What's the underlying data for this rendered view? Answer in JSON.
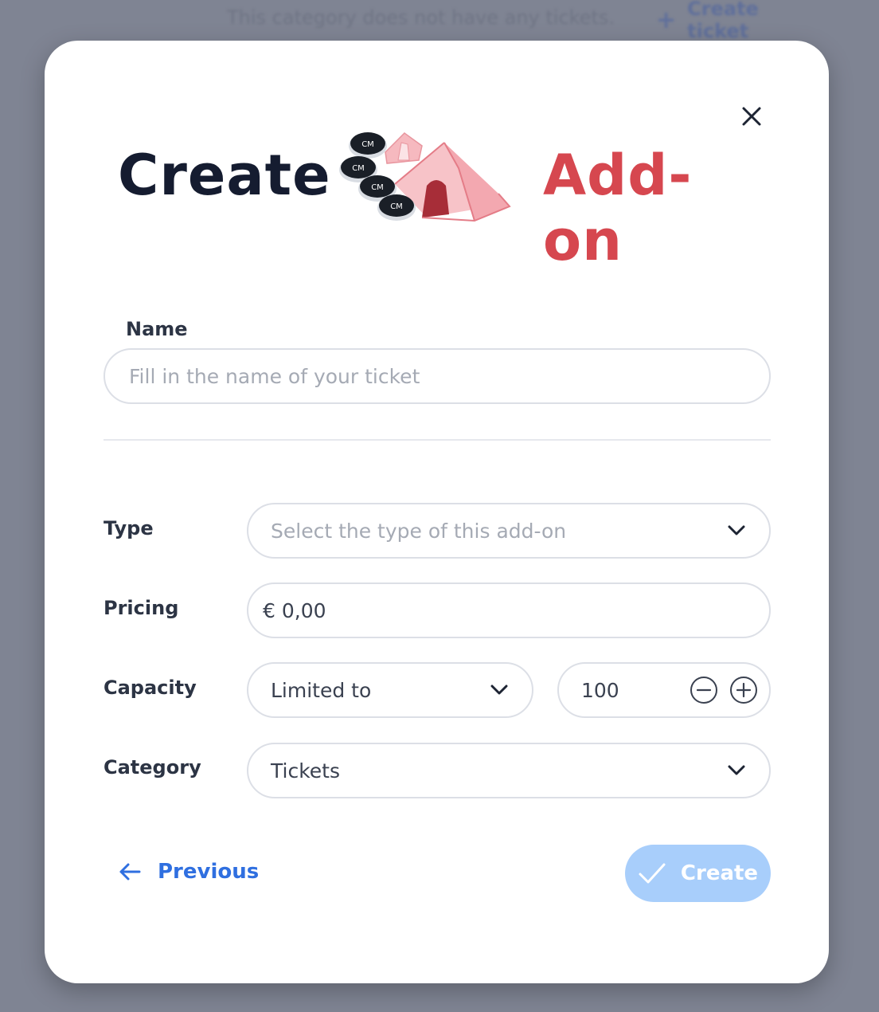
{
  "background": {
    "message": "This category does not have any tickets.",
    "create_ticket_label": "Create ticket"
  },
  "modal": {
    "title_create": "Create",
    "title_addon": "Add-on",
    "name_label": "Name",
    "name_placeholder": "Fill in the name of your ticket",
    "type_label": "Type",
    "type_placeholder": "Select the type of this add-on",
    "pricing_label": "Pricing",
    "pricing_value": "€ 0,00",
    "capacity_label": "Capacity",
    "capacity_mode": "Limited to",
    "capacity_value": "100",
    "category_label": "Category",
    "category_value": "Tickets",
    "previous_label": "Previous",
    "create_label": "Create"
  },
  "colors": {
    "accent": "#d6474f",
    "primary_link": "#2f6fe0",
    "create_disabled": "#a8cefb"
  }
}
